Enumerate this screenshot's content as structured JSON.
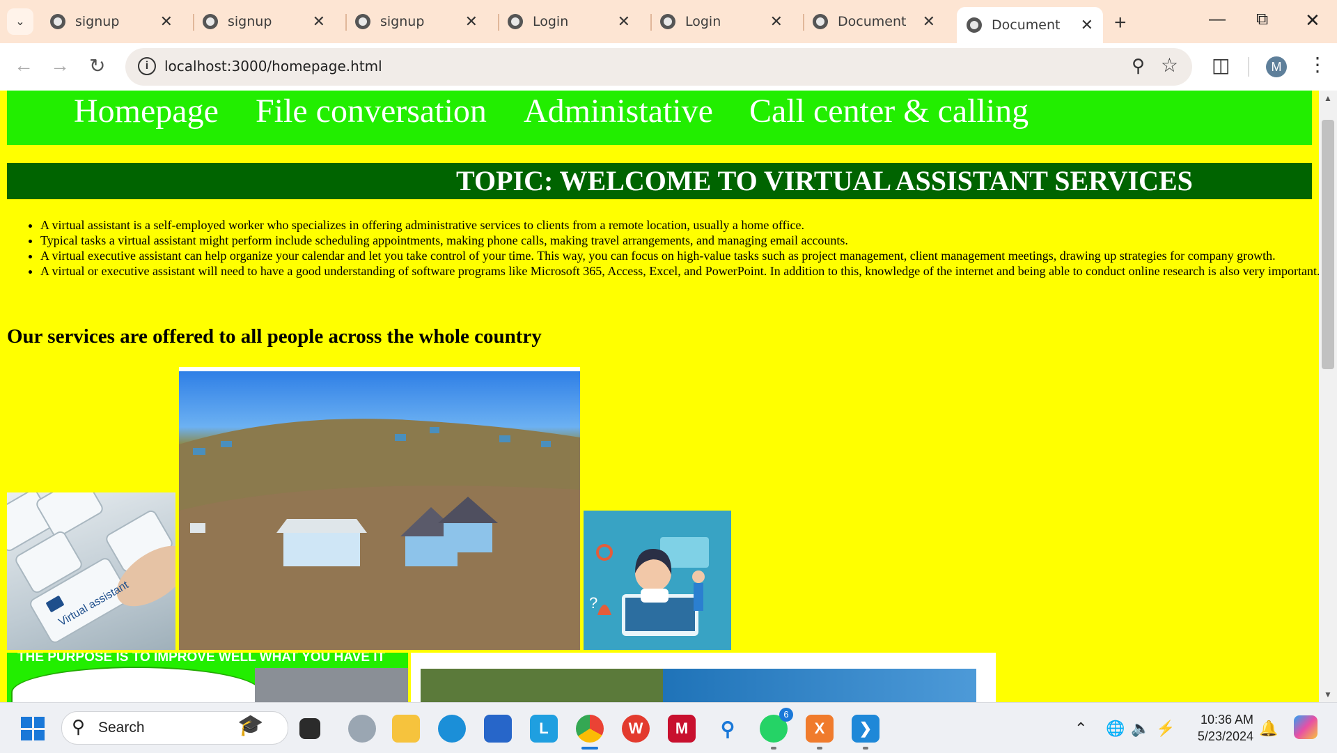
{
  "browser": {
    "tabs": [
      {
        "title": "signup"
      },
      {
        "title": "signup"
      },
      {
        "title": "signup"
      },
      {
        "title": "Login"
      },
      {
        "title": "Login"
      },
      {
        "title": "Document"
      },
      {
        "title": "Document",
        "active": true
      }
    ],
    "url": "localhost:3000/homepage.html",
    "profile_initial": "M"
  },
  "page": {
    "nav": [
      "Homepage",
      "File conversation",
      "Administative",
      "Call center & calling"
    ],
    "topic": "TOPIC: WELCOME TO VIRTUAL ASSISTANT SERVICES",
    "bullets": [
      "A virtual assistant is a self-employed worker who specializes in offering administrative services to clients from a remote location, usually a home office.",
      "Typical tasks a virtual assistant might perform include scheduling appointments, making phone calls, making travel arrangements, and managing email accounts.",
      "A virtual executive assistant can help organize your calendar and let you take control of your time. This way, you can focus on high-value tasks such as project management, client management meetings, drawing up strategies for company growth.",
      "A virtual or executive assistant will need to have a good understanding of software programs like Microsoft 365, Access, Excel, and PowerPoint. In addition to this, knowledge of the internet and being able to conduct online research is also very important."
    ],
    "services_heading": "Our services are offered to all people across the whole country",
    "keyboard_image_text": "Virtual assistant",
    "banner_text": "THE PURPOSE IS TO IMPROVE WELL WHAT YOU HAVE IT",
    "colors": {
      "page_bg": "#ffff00",
      "nav_bg": "#22ee00",
      "topic_bg": "#006400"
    }
  },
  "taskbar": {
    "search_label": "Search",
    "whatsapp_badge": "6",
    "time": "10:36 AM",
    "date": "5/23/2024"
  }
}
